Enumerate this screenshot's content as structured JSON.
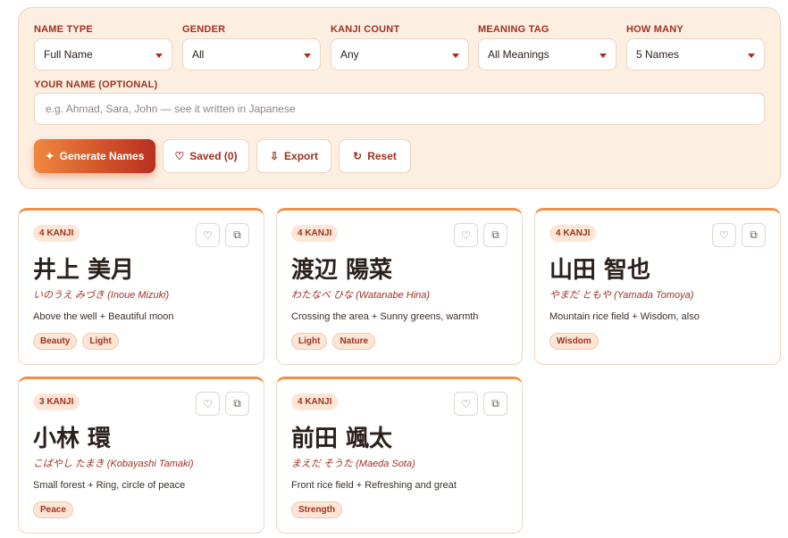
{
  "filters": {
    "name_type": {
      "label": "NAME TYPE",
      "value": "Full Name"
    },
    "gender": {
      "label": "GENDER",
      "value": "All"
    },
    "kanji_count": {
      "label": "KANJI COUNT",
      "value": "Any"
    },
    "meaning_tag": {
      "label": "MEANING TAG",
      "value": "All Meanings"
    },
    "how_many": {
      "label": "HOW MANY",
      "value": "5 Names"
    }
  },
  "your_name": {
    "label": "YOUR NAME (OPTIONAL)",
    "placeholder": "e.g. Ahmad, Sara, John — see it written in Japanese"
  },
  "actions": {
    "generate": {
      "icon": "sparkle-icon",
      "label": "Generate Names"
    },
    "saved": {
      "icon": "heart-icon",
      "label": "Saved (0)"
    },
    "export": {
      "icon": "download-icon",
      "label": "Export"
    },
    "reset": {
      "icon": "refresh-icon",
      "label": "Reset"
    }
  },
  "colors": {
    "accent": "#b3261e",
    "accent_gradient_start": "#f0873f",
    "panel_bg": "#fdeee2",
    "card_top_border": "#f09046",
    "tag_bg": "#fde6d6"
  },
  "cards": [
    {
      "badge": "4 KANJI",
      "kanji": "井上 美月",
      "kana": "いのうえ みづき",
      "romaji": "(Inoue Mizuki)",
      "meaning": "Above the well + Beautiful moon",
      "tags": [
        "Beauty",
        "Light"
      ]
    },
    {
      "badge": "4 KANJI",
      "kanji": "渡辺 陽菜",
      "kana": "わたなべ ひな",
      "romaji": "(Watanabe Hina)",
      "meaning": "Crossing the area + Sunny greens, warmth",
      "tags": [
        "Light",
        "Nature"
      ]
    },
    {
      "badge": "4 KANJI",
      "kanji": "山田 智也",
      "kana": "やまだ ともや",
      "romaji": "(Yamada Tomoya)",
      "meaning": "Mountain rice field + Wisdom, also",
      "tags": [
        "Wisdom"
      ]
    },
    {
      "badge": "3 KANJI",
      "kanji": "小林 環",
      "kana": "こばやし たまき",
      "romaji": "(Kobayashi Tamaki)",
      "meaning": "Small forest + Ring, circle of peace",
      "tags": [
        "Peace"
      ]
    },
    {
      "badge": "4 KANJI",
      "kanji": "前田 颯太",
      "kana": "まえだ そうた",
      "romaji": "(Maeda Sota)",
      "meaning": "Front rice field + Refreshing and great",
      "tags": [
        "Strength"
      ]
    }
  ],
  "card_icons": {
    "favorite": "heart-outline-icon",
    "copy": "copy-icon"
  }
}
